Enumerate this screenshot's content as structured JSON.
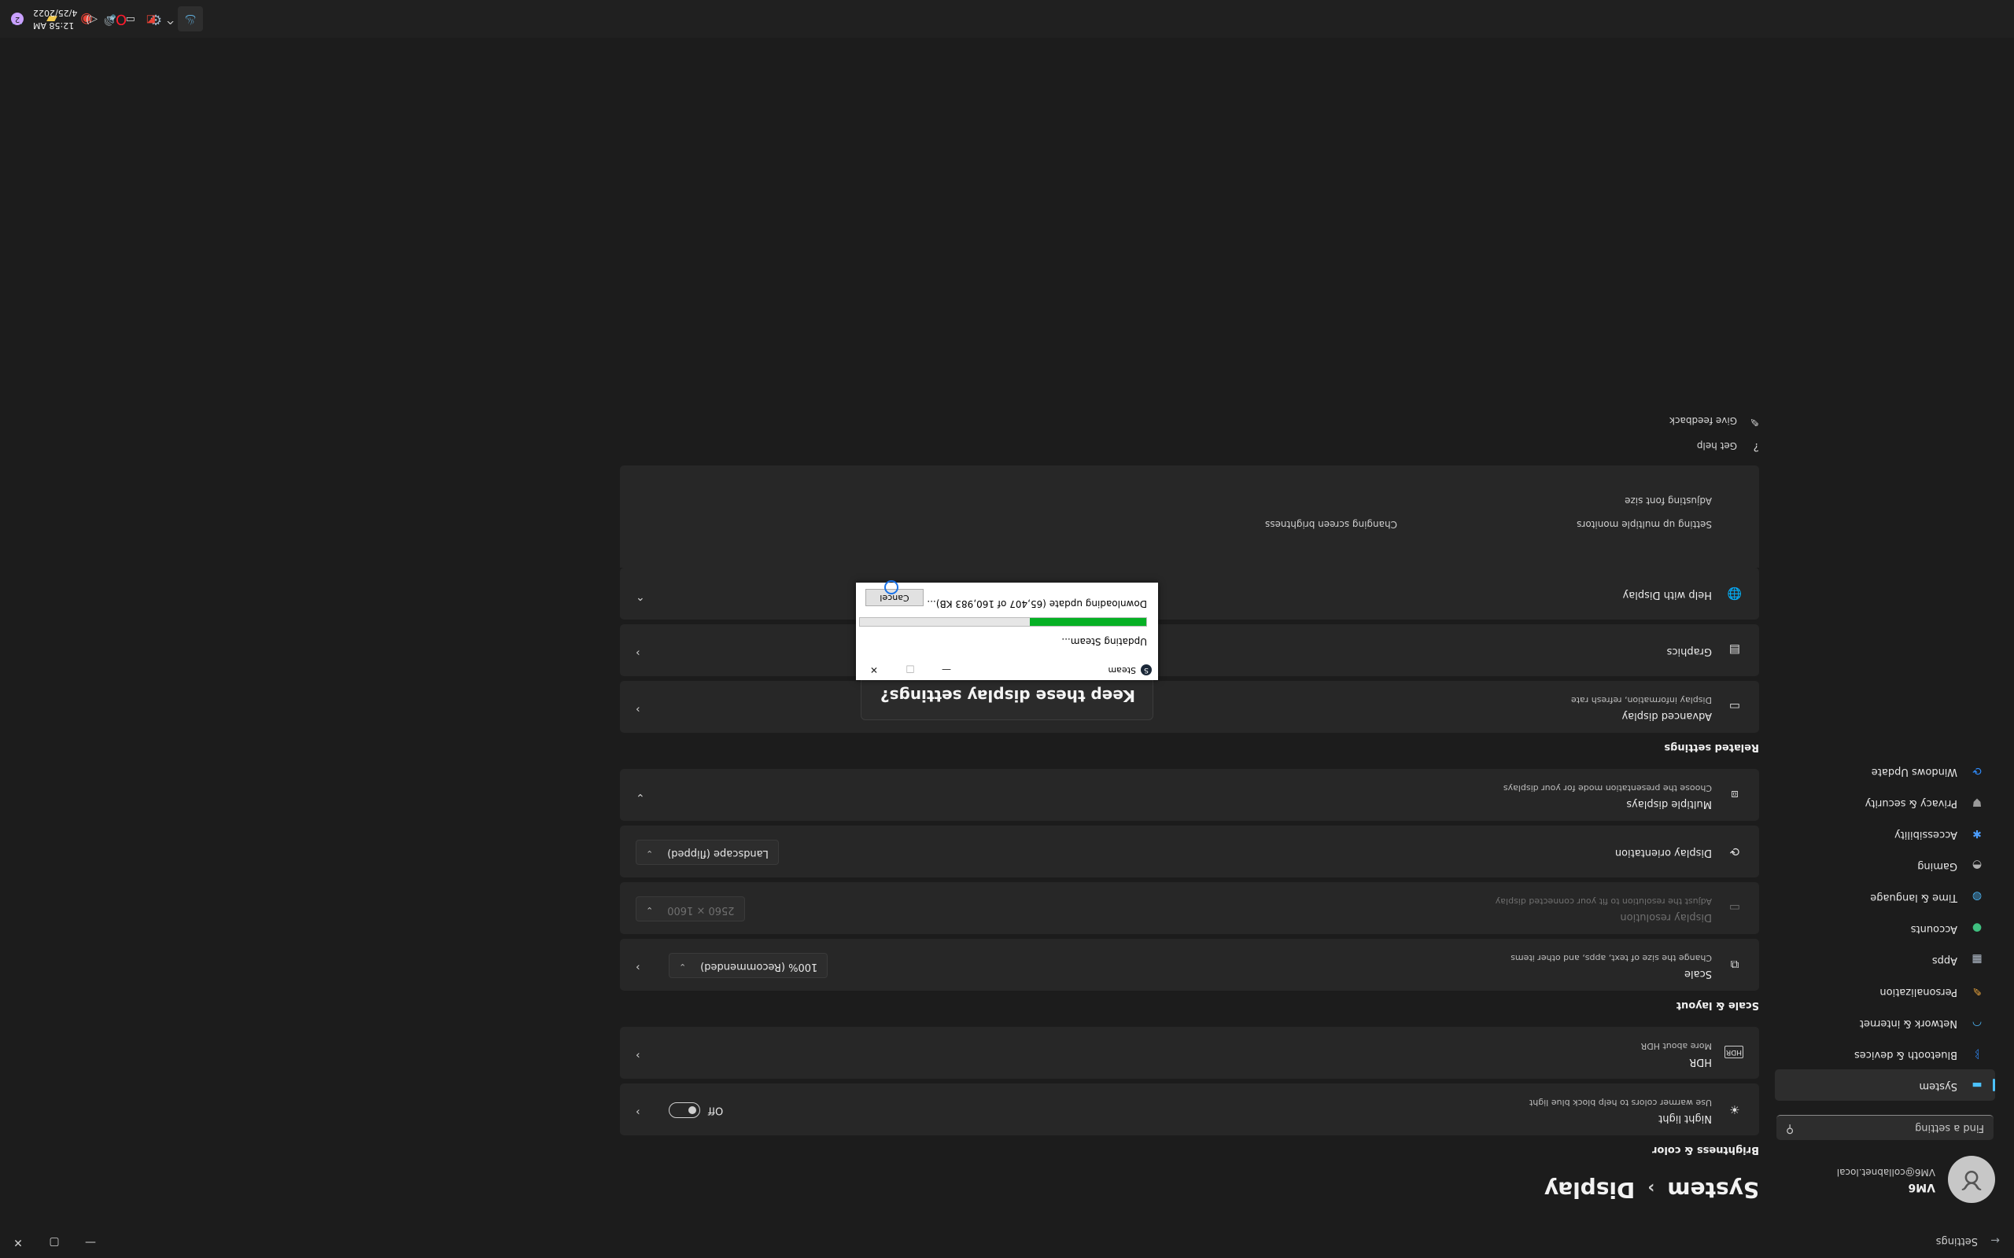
{
  "settings_window": {
    "title": "Settings",
    "back_icon": "back-arrow-icon",
    "controls": {
      "minimize": "—",
      "maximize": "▢",
      "close": "✕"
    }
  },
  "profile": {
    "name": "VM6",
    "email": "VM6@collabnet.local",
    "avatar_icon": "user-avatar-icon"
  },
  "search": {
    "placeholder": "Find a setting",
    "icon": "search-icon"
  },
  "nav": {
    "items": [
      {
        "label": "System",
        "icon": "monitor-icon",
        "color": "#4cc2ff",
        "active": true
      },
      {
        "label": "Bluetooth & devices",
        "icon": "bluetooth-icon",
        "color": "#2f8cff"
      },
      {
        "label": "Network & internet",
        "icon": "wifi-icon",
        "color": "#4cb5f5"
      },
      {
        "label": "Personalization",
        "icon": "brush-icon",
        "color": "#e8a33c"
      },
      {
        "label": "Apps",
        "icon": "apps-icon",
        "color": "#b7c2d0"
      },
      {
        "label": "Accounts",
        "icon": "account-icon",
        "color": "#3fbf7f"
      },
      {
        "label": "Time & language",
        "icon": "globe-clock-icon",
        "color": "#4cb5f5"
      },
      {
        "label": "Gaming",
        "icon": "gamepad-icon",
        "color": "#b0b0b0"
      },
      {
        "label": "Accessibility",
        "icon": "accessibility-icon",
        "color": "#4c9eff"
      },
      {
        "label": "Privacy & security",
        "icon": "shield-icon",
        "color": "#9a9a9a"
      },
      {
        "label": "Windows Update",
        "icon": "sync-icon",
        "color": "#2f8cff"
      }
    ]
  },
  "breadcrumb": {
    "parent": "System",
    "separator": "›",
    "current": "Display"
  },
  "brightness": {
    "heading": "Brightness & color",
    "night_light": {
      "title": "Night light",
      "subtitle": "Use warmer colors to help block blue light",
      "state": "Off",
      "icon": "sun-icon"
    },
    "hdr": {
      "title": "HDR",
      "subtitle": "More about HDR",
      "icon": "hdr-icon"
    }
  },
  "scale_layout": {
    "heading": "Scale & layout",
    "scale": {
      "title": "Scale",
      "subtitle": "Change the size of text, apps, and other items",
      "value": "100% (Recommended)",
      "icon": "scale-icon"
    },
    "resolution": {
      "title": "Display resolution",
      "subtitle": "Adjust the resolution to fit your connected display",
      "value": "2560 × 1600",
      "icon": "resolution-icon"
    },
    "orientation": {
      "title": "Display orientation",
      "value": "Landscape (flipped)",
      "icon": "orientation-icon"
    },
    "multiple_displays": {
      "title": "Multiple displays",
      "subtitle": "Choose the presentation mode for your displays",
      "icon": "multi-display-icon"
    }
  },
  "related": {
    "heading": "Related settings",
    "advanced": {
      "title": "Advanced display",
      "subtitle": "Display information, refresh rate",
      "icon": "monitor-outline-icon"
    },
    "graphics": {
      "title": "Graphics",
      "icon": "graphics-icon"
    }
  },
  "help": {
    "title": "Help with Display",
    "icon": "globe-icon",
    "links": [
      "Setting up multiple monitors",
      "Changing screen brightness",
      "Adjusting font size"
    ]
  },
  "footer": {
    "get_help": {
      "label": "Get help",
      "icon": "help-icon"
    },
    "feedback": {
      "label": "Give feedback",
      "icon": "feedback-icon"
    }
  },
  "keep_dialog": {
    "question": "Keep these display settings?"
  },
  "steam": {
    "title": "Steam",
    "status": "Updating Steam...",
    "detail": "Downloading update (65,407 of 160,983 KB)...",
    "progress_fraction": 0.406,
    "cancel_label": "Cancel",
    "controls": {
      "minimize": "—",
      "maximize": "□",
      "close": "✕"
    }
  },
  "taskbar": {
    "apps": [
      {
        "icon": "windows-start-icon",
        "color": "#4cc2ff"
      },
      {
        "icon": "file-explorer-icon",
        "color": "#f2c94c"
      },
      {
        "icon": "chrome-icon",
        "color": "#e94235"
      },
      {
        "icon": "opera-icon",
        "color": "#ff1b2d"
      },
      {
        "icon": "settings-gear-icon",
        "color": "#9fb3c8"
      },
      {
        "icon": "steam-icon",
        "color": "#66c0f4"
      }
    ],
    "tray": {
      "chevron": "^",
      "time": "12:58 AM",
      "date": "4/25/2022",
      "notifications": "2"
    }
  }
}
